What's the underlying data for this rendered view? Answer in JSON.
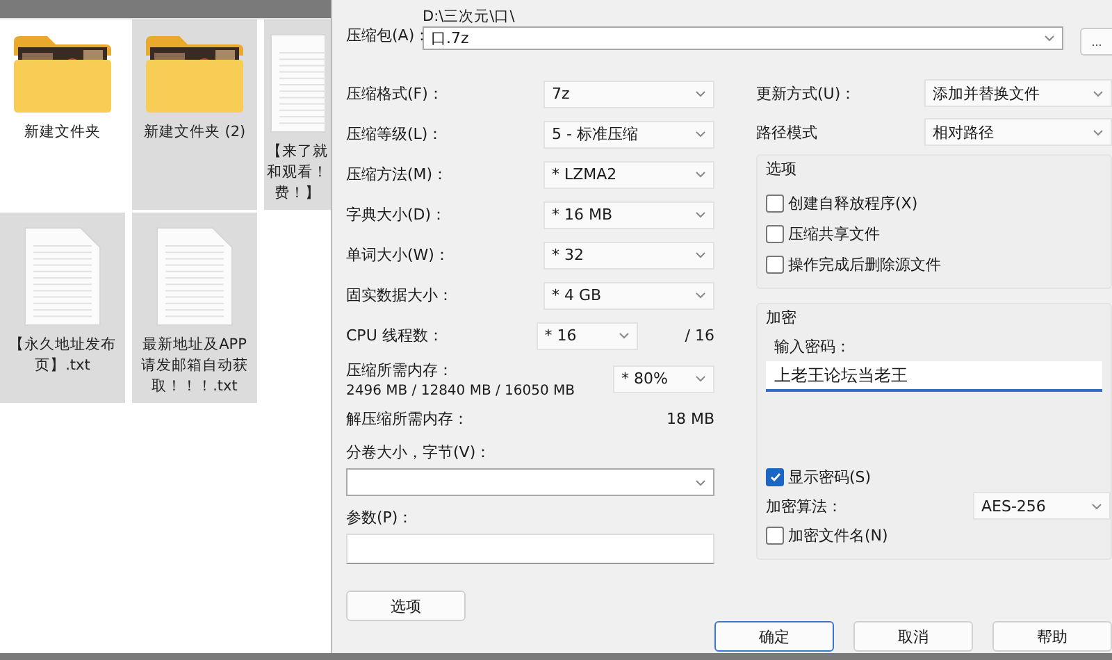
{
  "explorer": {
    "items": [
      {
        "name": "新建文件夹",
        "kind": "folder",
        "selected": false
      },
      {
        "name": "新建文件夹 (2)",
        "kind": "folder",
        "selected": true
      },
      {
        "name": "【来了就和观看！费！】",
        "kind": "text_cut",
        "selected": true
      },
      {
        "name": "【永久地址发布页】.txt",
        "kind": "text",
        "selected": true
      },
      {
        "name": "最新地址及APP请发邮箱自动获取！！！.txt",
        "kind": "text",
        "selected": true
      }
    ]
  },
  "dialog": {
    "archive": {
      "label": "压缩包(A)：",
      "path": "D:\\三次元\\口\\",
      "value": "口.7z",
      "browse": "..."
    },
    "left_rows": [
      {
        "kind": "select",
        "label": "压缩格式(F)：",
        "value": "7z"
      },
      {
        "kind": "select",
        "label": "压缩等级(L)：",
        "value": "5 - 标准压缩"
      },
      {
        "kind": "select",
        "label": "压缩方法(M)：",
        "value": "* LZMA2"
      },
      {
        "kind": "select",
        "label": "字典大小(D)：",
        "value": "* 16 MB"
      },
      {
        "kind": "select",
        "label": "单词大小(W)：",
        "value": "* 32"
      },
      {
        "kind": "select",
        "label": "固实数据大小：",
        "value": "* 4 GB"
      },
      {
        "kind": "select_suffix",
        "label": "CPU 线程数：",
        "value": "* 16",
        "suffix": "/ 16"
      },
      {
        "kind": "memory",
        "label": "压缩所需内存：",
        "note": "2496 MB / 12840 MB / 16050 MB",
        "value": "* 80%"
      },
      {
        "kind": "reading",
        "label": "解压缩所需内存：",
        "value": "18 MB"
      },
      {
        "kind": "wide_select",
        "label": "分卷大小，字节(V)："
      },
      {
        "kind": "wide_input",
        "label": "参数(P)："
      }
    ],
    "options_button": "选项",
    "update": {
      "label": "更新方式(U)：",
      "value": "添加并替换文件"
    },
    "path_mode": {
      "label": "路径模式",
      "value": "相对路径"
    },
    "options_group": {
      "title": "选项",
      "checkboxes": [
        {
          "label": "创建自释放程序(X)",
          "checked": false
        },
        {
          "label": "压缩共享文件",
          "checked": false
        },
        {
          "label": "操作完成后删除源文件",
          "checked": false
        }
      ]
    },
    "encryption": {
      "title": "加密",
      "password_label": "输入密码：",
      "password": "上老王论坛当老王",
      "show_password": {
        "label": "显示密码(S)",
        "checked": true
      },
      "method_label": "加密算法：",
      "method": "AES-256",
      "encrypt_names": {
        "label": "加密文件名(N)",
        "checked": false
      }
    },
    "buttons": [
      {
        "label": "确定",
        "default": true
      },
      {
        "label": "取消",
        "default": false
      },
      {
        "label": "帮助",
        "default": false
      }
    ]
  }
}
